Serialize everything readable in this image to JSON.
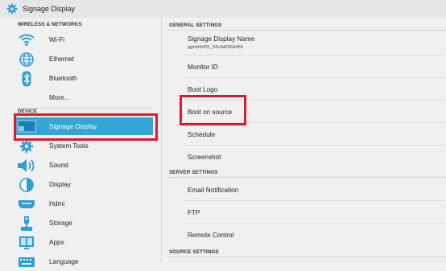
{
  "window": {
    "title": "Signage Display"
  },
  "sidebar": {
    "sections": [
      {
        "header": "WIRELESS & NETWORKS"
      },
      {
        "header": "DEVICE"
      }
    ],
    "items": [
      {
        "label": "Wi-Fi",
        "icon": "wifi-icon"
      },
      {
        "label": "Ethernet",
        "icon": "globe-icon"
      },
      {
        "label": "Bluetooth",
        "icon": "bluetooth-icon"
      },
      {
        "label": "More..."
      },
      {
        "label": "Signage Display",
        "icon": "display-icon",
        "selected": true
      },
      {
        "label": "System Tools",
        "icon": "gear-icon"
      },
      {
        "label": "Sound",
        "icon": "speaker-icon"
      },
      {
        "label": "Display",
        "icon": "brightness-icon"
      },
      {
        "label": "Hdmi",
        "icon": "hdmi-icon"
      },
      {
        "label": "Storage",
        "icon": "storage-icon"
      },
      {
        "label": "Apps",
        "icon": "apps-icon"
      },
      {
        "label": "Language",
        "icon": "keyboard-icon"
      }
    ]
  },
  "main": {
    "general_header": "GENERAL SETTINGS",
    "server_header": "SERVER SETTINGS",
    "source_header": "SOURCE SETTINGS",
    "general_items": [
      {
        "label": "Signage Display Name",
        "sub": "gghhhhPD_34c3d266d465"
      },
      {
        "label": "Monitor ID"
      },
      {
        "label": "Boot Logo"
      },
      {
        "label": "Boot on source"
      },
      {
        "label": "Schedule"
      },
      {
        "label": "Screenshot"
      }
    ],
    "server_items": [
      {
        "label": "Email Notification"
      },
      {
        "label": "FTP"
      },
      {
        "label": "Remote Control"
      }
    ]
  },
  "colors": {
    "selection": "#33a6d5",
    "highlight": "#e0182b",
    "icon": "#2d9fd4"
  }
}
